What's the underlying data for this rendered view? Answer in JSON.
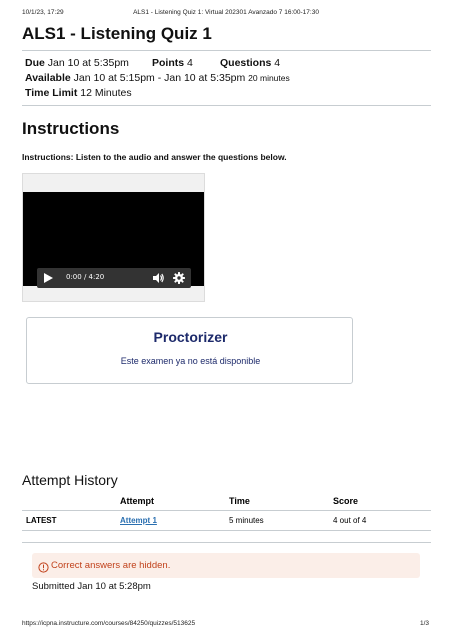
{
  "print_header": {
    "datetime": "10/1/23, 17:29",
    "doc_title": "ALS1 - Listening Quiz 1: Virtual 202301 Avanzado 7 16:00-17:30"
  },
  "quiz": {
    "title": "ALS1 - Listening Quiz 1",
    "due_label": "Due",
    "due_value": "Jan 10 at 5:35pm",
    "points_label": "Points",
    "points_value": "4",
    "questions_label": "Questions",
    "questions_value": "4",
    "available_label": "Available",
    "available_value": "Jan 10 at 5:15pm - Jan 10 at 5:35pm",
    "available_duration": "20 minutes",
    "time_limit_label": "Time Limit",
    "time_limit_value": "12 Minutes"
  },
  "instructions": {
    "heading": "Instructions",
    "text": "Instructions:  Listen to the audio and answer the questions below."
  },
  "video": {
    "time": "0:00 / 4:20",
    "play_icon": "play-icon",
    "volume_icon": "volume-icon",
    "settings_icon": "gear-icon"
  },
  "proctorizer": {
    "title": "Proctorizer",
    "message": "Este examen ya no está disponible"
  },
  "attempt_history": {
    "heading": "Attempt History",
    "columns": [
      "",
      "Attempt",
      "Time",
      "Score"
    ],
    "rows": [
      {
        "label": "LATEST",
        "attempt": "Attempt 1",
        "time": "5 minutes",
        "score": "4 out of 4"
      }
    ]
  },
  "alert": {
    "text": "Correct answers are hidden.",
    "color": "#c1421c"
  },
  "submitted": "Submitted Jan 10 at 5:28pm",
  "print_footer": {
    "url": "https://icpna.instructure.com/courses/84250/quizzes/513625",
    "page": "1/3"
  }
}
